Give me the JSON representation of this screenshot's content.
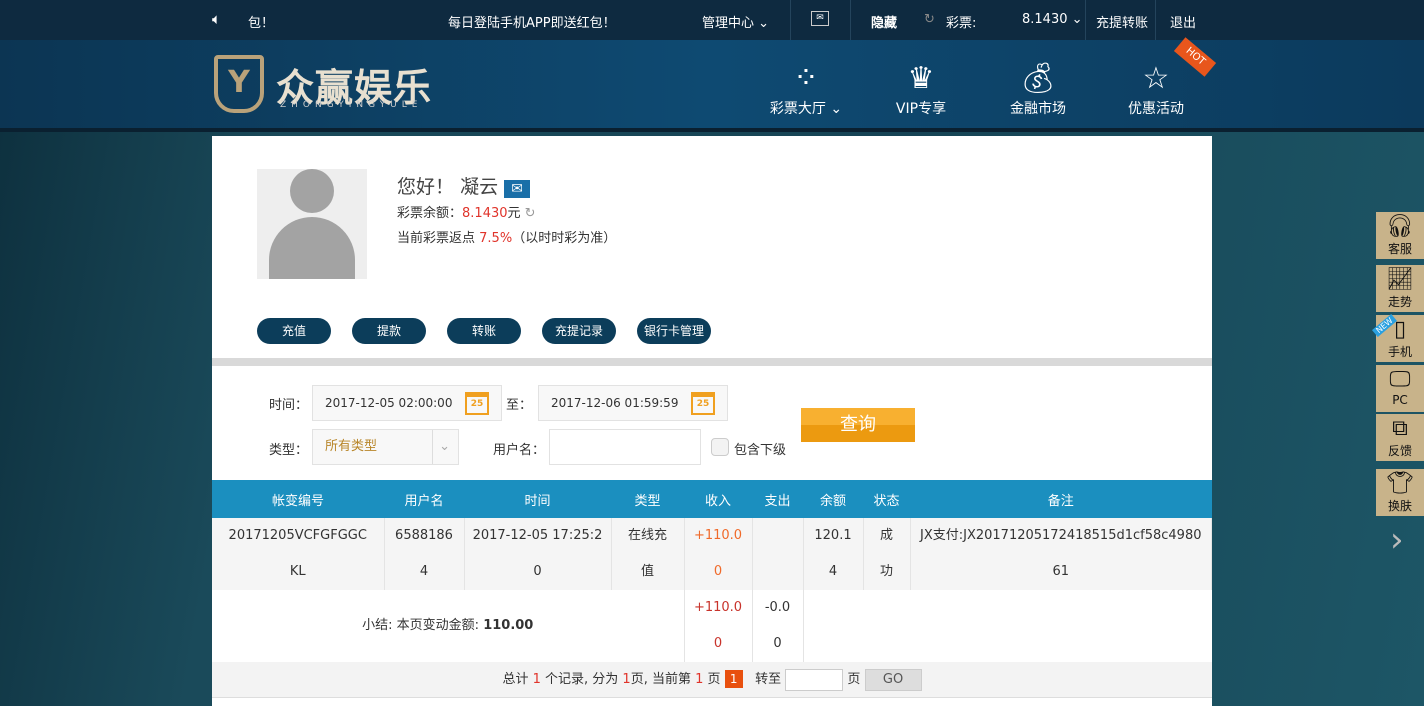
{
  "topbar": {
    "marquee": "包！",
    "promo": "每日登陆手机APP即送红包！",
    "manage": "管理中心",
    "hide": "隐藏",
    "lottery_label": "彩票:",
    "balance": "8.1430",
    "deposit_transfer": "充提转账",
    "logout": "退出"
  },
  "logo": {
    "cn": "众赢娱乐",
    "en": "ZHONGYINGYULE"
  },
  "nav": [
    {
      "label": "彩票大厅",
      "icon": "grid-icon"
    },
    {
      "label": "VIP专享",
      "icon": "crown-icon"
    },
    {
      "label": "金融市场",
      "icon": "money-bag-icon"
    },
    {
      "label": "优惠活动",
      "icon": "star-icon"
    }
  ],
  "hot_badge": "HOT",
  "profile": {
    "greeting": "您好！",
    "username": "凝云",
    "balance_label": "彩票余额：",
    "balance": "8.1430",
    "unit": "元",
    "rebate_label": "当前彩票返点",
    "rebate": "7.5%",
    "rebate_note": "（以时时彩为准）"
  },
  "actions": [
    "充值",
    "提款",
    "转账",
    "充提记录",
    "银行卡管理"
  ],
  "filter": {
    "time_label": "时间：",
    "start": "2017-12-05 02:00:00",
    "to_label": "至：",
    "end": "2017-12-06 01:59:59",
    "cal_day": "25",
    "type_label": "类型：",
    "type_value": "所有类型",
    "user_label": "用户名：",
    "user_value": "",
    "include_sub": "包含下级",
    "query": "查询"
  },
  "table": {
    "headers": [
      "帐变编号",
      "用户名",
      "时间",
      "类型",
      "收入",
      "支出",
      "余额",
      "状态",
      "备注"
    ],
    "rows": [
      [
        "20171205VCFGFGGC",
        "6588186",
        "2017-12-05 17:25:2",
        "在线充",
        "+110.0",
        "",
        "120.1",
        "成",
        "JX支付:JX20171205172418515d1cf58c4980"
      ],
      [
        "KL",
        "4",
        "0",
        "值",
        "0",
        "",
        "4",
        "功",
        "61"
      ]
    ],
    "subtotal_label": "小结: 本页变动金额:",
    "subtotal": "110.00",
    "income": [
      "+110.0",
      "0"
    ],
    "expense": [
      "-0.0",
      "0"
    ]
  },
  "pager": {
    "t1": "总计",
    "total": "1",
    "t2": "个记录, 分为",
    "pages": "1",
    "t3": "页, 当前第",
    "current": "1",
    "t4": "页",
    "page_btn": "1",
    "goto": "转至",
    "page_unit": "页",
    "go": "GO"
  },
  "side": [
    {
      "label": "客服",
      "icon": "headset-icon"
    },
    {
      "label": "走势",
      "icon": "trend-icon"
    },
    {
      "label": "手机",
      "icon": "phone-icon"
    },
    {
      "label": "PC",
      "icon": "monitor-icon"
    },
    {
      "label": "反馈",
      "icon": "feedback-icon"
    },
    {
      "label": "换肤",
      "icon": "tshirt-icon"
    }
  ],
  "new_badge": "NEW"
}
